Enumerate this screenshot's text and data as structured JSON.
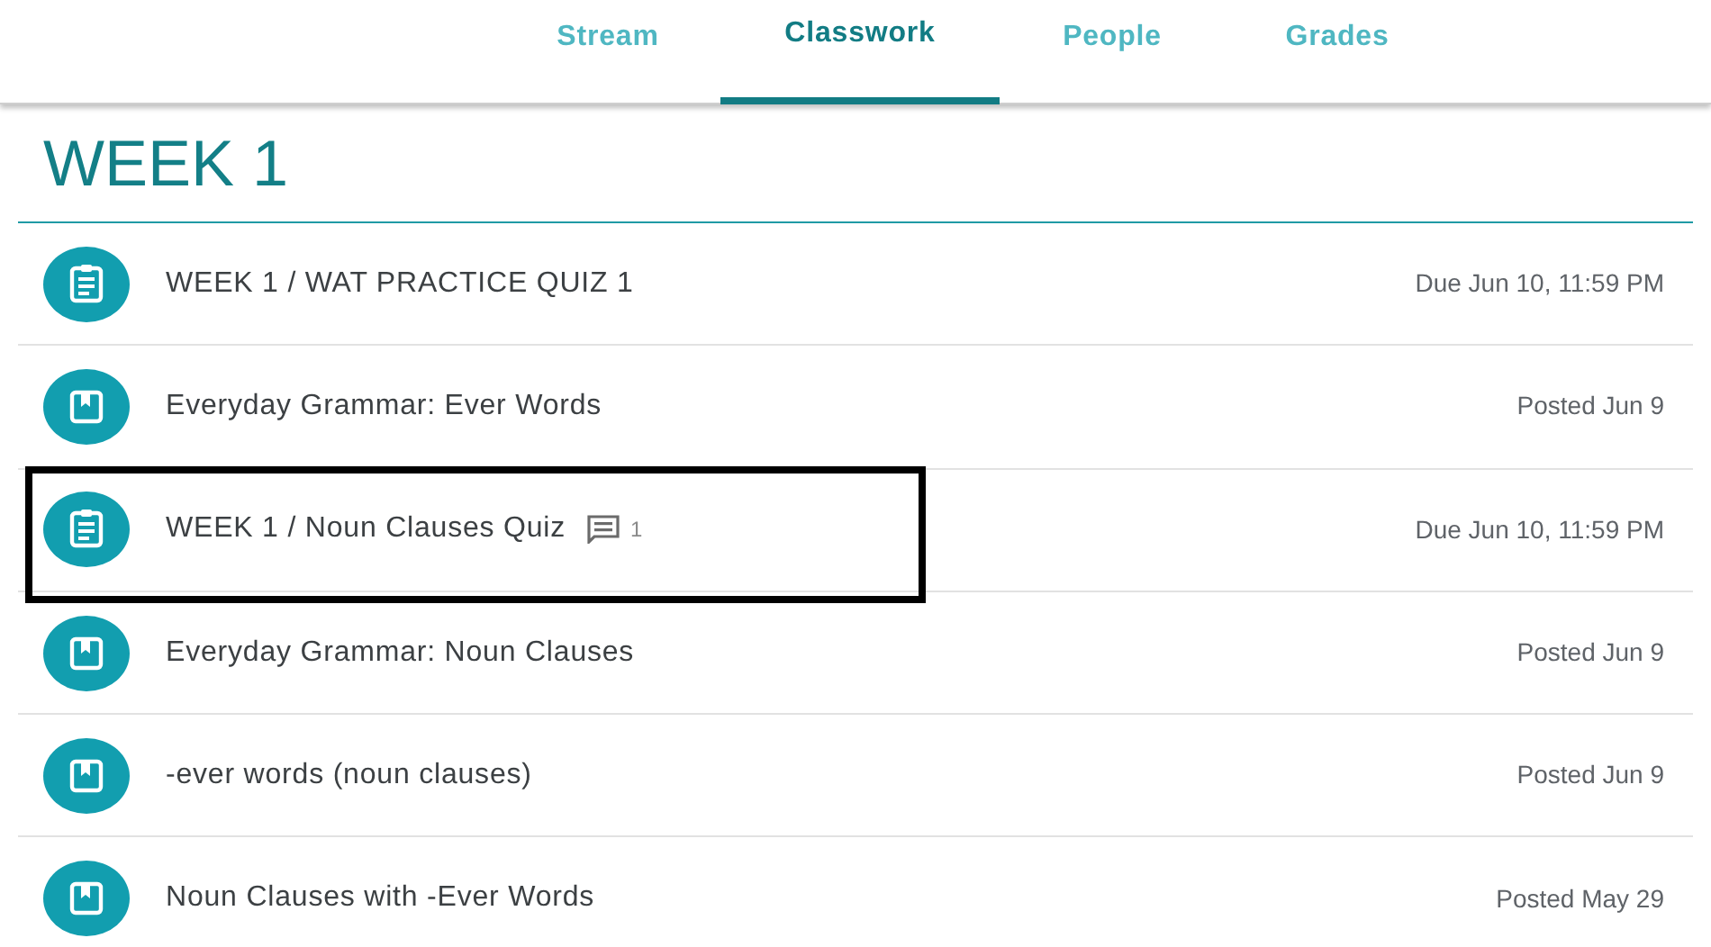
{
  "tabs": [
    {
      "label": "Stream",
      "selected": false
    },
    {
      "label": "Classwork",
      "selected": true
    },
    {
      "label": "People",
      "selected": false
    },
    {
      "label": "Grades",
      "selected": false
    }
  ],
  "topic": {
    "title": "WEEK 1"
  },
  "items": [
    {
      "kind": "assignment",
      "title": "WEEK 1 / WAT PRACTICE QUIZ 1",
      "date": "Due Jun 10, 11:59 PM",
      "highlighted": false
    },
    {
      "kind": "material",
      "title": "Everyday Grammar: Ever Words",
      "date": "Posted Jun 9",
      "highlighted": false
    },
    {
      "kind": "assignment",
      "title": "WEEK 1 / Noun Clauses Quiz",
      "comments": "1",
      "date": "Due Jun 10, 11:59 PM",
      "highlighted": true
    },
    {
      "kind": "material",
      "title": "Everyday Grammar: Noun Clauses",
      "date": "Posted Jun 9",
      "highlighted": false
    },
    {
      "kind": "material",
      "title": "-ever words (noun clauses)",
      "date": "Posted Jun 9",
      "highlighted": false
    },
    {
      "kind": "material",
      "title": "Noun Clauses with -Ever Words",
      "date": "Posted May 29",
      "highlighted": false
    }
  ]
}
